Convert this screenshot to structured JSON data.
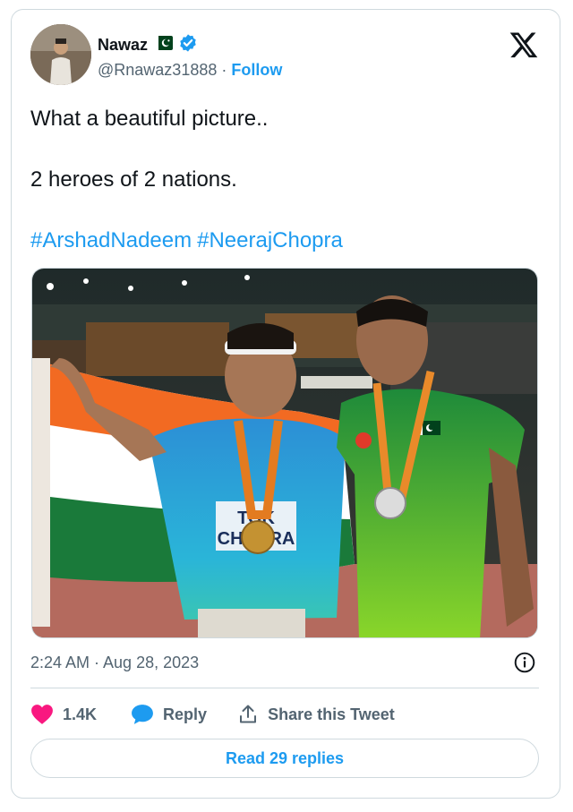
{
  "author": {
    "display_name": "Nawaz",
    "flag_emoji": "🇵🇰",
    "verified_icon": "verified-badge-icon",
    "handle": "@Rnawaz31888",
    "separator": " · ",
    "follow_label": "Follow"
  },
  "brand": {
    "logo_icon": "x-logo-icon"
  },
  "tweet": {
    "line1": "What a beautiful picture..",
    "line2": "2 heroes of 2 nations.",
    "hashtags": [
      "#ArshadNadeem",
      "#NeerajChopra"
    ]
  },
  "photo": {
    "description_icon": "photo-image",
    "bib_text_top": "TOK",
    "bib_text_bottom": "CHOPRA"
  },
  "meta": {
    "timestamp": "2:24 AM · Aug 28, 2023"
  },
  "actions": {
    "like_count": "1.4K",
    "reply_label": "Reply",
    "share_label": "Share this Tweet"
  },
  "footer": {
    "read_replies_label": "Read 29 replies"
  },
  "colors": {
    "accent": "#1d9bf0",
    "like": "#f91880",
    "text_primary": "#0f1419",
    "text_secondary": "#536471",
    "border": "#cfd9de",
    "verified": "#1d9bf0"
  }
}
